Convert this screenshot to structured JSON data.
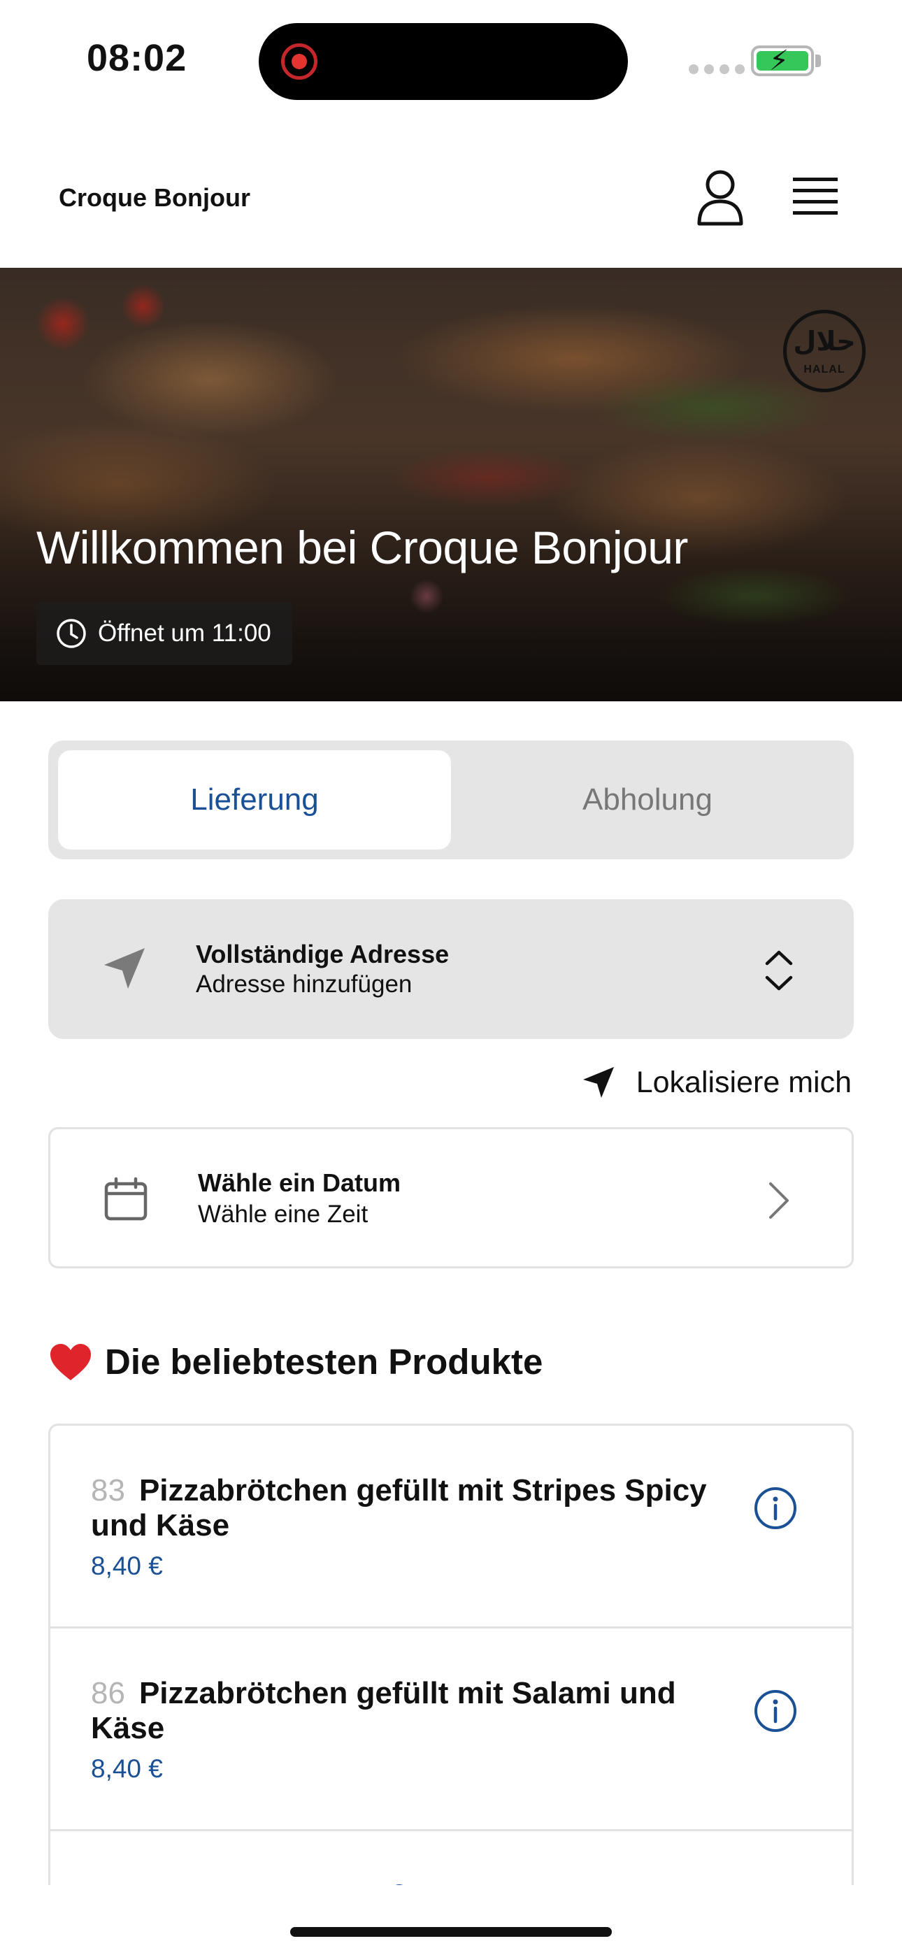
{
  "status_bar": {
    "time": "08:02",
    "battery_color": "#35c759",
    "recording_color": "#e3342f"
  },
  "header": {
    "brand": "Croque Bonjour",
    "icons": [
      "user-icon",
      "menu-icon"
    ]
  },
  "hero": {
    "title": "Willkommen bei Croque Bonjour",
    "hours": "Öffnet um 11:00",
    "badge_arabic": "حلال",
    "badge_text": "HALAL"
  },
  "order_mode": {
    "options": [
      "Lieferung",
      "Abholung"
    ],
    "selected": "Lieferung",
    "accent_color": "#1a5096"
  },
  "address": {
    "title": "Vollständige Adresse",
    "subtitle": "Adresse hinzufügen"
  },
  "locate": {
    "label": "Lokalisiere mich"
  },
  "schedule": {
    "title": "Wähle ein Datum",
    "subtitle": "Wähle eine Zeit"
  },
  "popular": {
    "title": "Die beliebtesten Produkte",
    "items": [
      {
        "number": "83",
        "name": "Pizzabrötchen gefüllt mit Stripes Spicy und Käse",
        "price": "8,40 €"
      },
      {
        "number": "86",
        "name": "Pizzabrötchen gefüllt mit Salami und Käse",
        "price": "8,40 €"
      }
    ]
  }
}
